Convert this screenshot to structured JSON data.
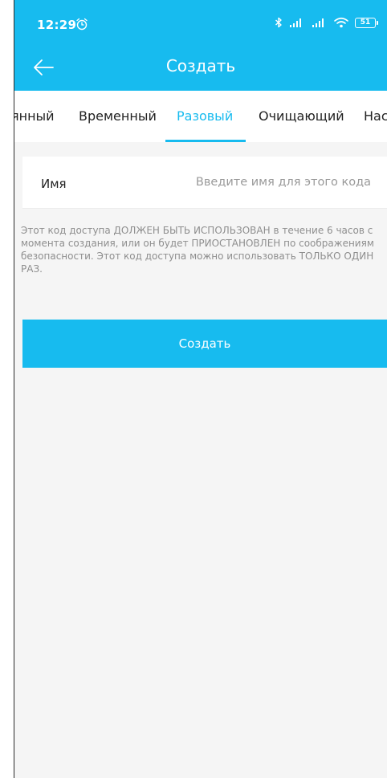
{
  "status_bar": {
    "time": "12:29",
    "battery": "51",
    "icons": [
      "alarm-icon",
      "bluetooth-icon",
      "signal-icon",
      "signal-icon",
      "wifi-icon",
      "battery-icon"
    ]
  },
  "app_bar": {
    "title": "Создать",
    "back_icon": "arrow-left-icon"
  },
  "tabs": [
    {
      "label": "янный",
      "active": false
    },
    {
      "label": "Временный",
      "active": false
    },
    {
      "label": "Разовый",
      "active": true
    },
    {
      "label": "Очищающий",
      "active": false
    },
    {
      "label": "Нас",
      "active": false
    }
  ],
  "form": {
    "name_label": "Имя",
    "name_placeholder": "Введите имя для этого кода",
    "name_value": ""
  },
  "info": {
    "text": "Этот код доступа ДОЛЖЕН БЫТЬ ИСПОЛЬЗОВАН в течение 6 часов с момента создания, или он будет ПРИОСТАНОВЛЕН по соображениям безопасности. Этот код доступа можно использовать ТОЛЬКО ОДИН РАЗ."
  },
  "actions": {
    "create_label": "Создать"
  },
  "colors": {
    "accent": "#17bbef",
    "background": "#f5f5f5",
    "text": "#222222",
    "muted": "#8e8e8e"
  }
}
